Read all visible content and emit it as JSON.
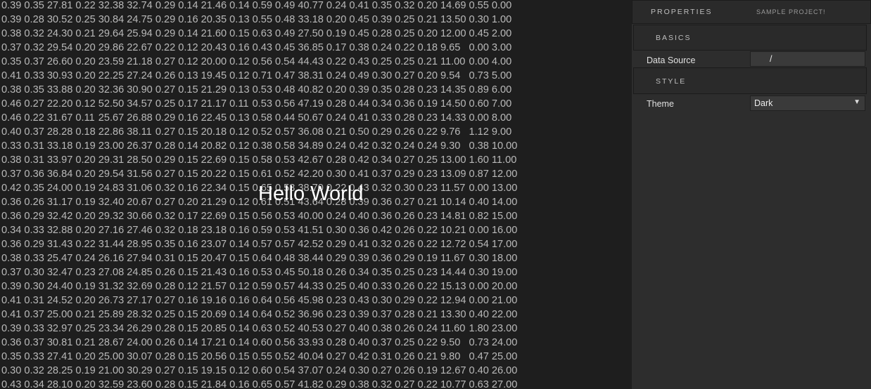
{
  "hello_text": "Hello World",
  "table": [
    [
      "0.39",
      "0.35",
      "27.81",
      "0.22",
      "32.38",
      "32.74",
      "0.29",
      "0.14",
      "21.46",
      "0.14",
      "0.59",
      "0.49",
      "40.77",
      "0.24",
      "0.41",
      "0.35",
      "0.32",
      "0.20",
      "14.69",
      "0.55",
      "0.00"
    ],
    [
      "0.39",
      "0.28",
      "30.52",
      "0.25",
      "30.84",
      "24.75",
      "0.29",
      "0.16",
      "20.35",
      "0.13",
      "0.55",
      "0.48",
      "33.18",
      "0.20",
      "0.45",
      "0.39",
      "0.25",
      "0.21",
      "13.50",
      "0.30",
      "1.00"
    ],
    [
      "0.38",
      "0.32",
      "24.30",
      "0.21",
      "29.64",
      "25.94",
      "0.29",
      "0.14",
      "21.60",
      "0.15",
      "0.63",
      "0.49",
      "27.50",
      "0.19",
      "0.45",
      "0.28",
      "0.25",
      "0.20",
      "12.00",
      "0.45",
      "2.00"
    ],
    [
      "0.37",
      "0.32",
      "29.54",
      "0.20",
      "29.86",
      "22.67",
      "0.22",
      "0.12",
      "20.43",
      "0.16",
      "0.43",
      "0.45",
      "36.85",
      "0.17",
      "0.38",
      "0.24",
      "0.22",
      "0.18",
      "9.65",
      "0.00",
      "3.00"
    ],
    [
      "0.35",
      "0.37",
      "26.60",
      "0.20",
      "23.59",
      "21.18",
      "0.27",
      "0.12",
      "20.00",
      "0.12",
      "0.56",
      "0.54",
      "44.43",
      "0.22",
      "0.43",
      "0.25",
      "0.25",
      "0.21",
      "11.00",
      "0.00",
      "4.00"
    ],
    [
      "0.41",
      "0.33",
      "30.93",
      "0.20",
      "22.25",
      "27.24",
      "0.26",
      "0.13",
      "19.45",
      "0.12",
      "0.71",
      "0.47",
      "38.31",
      "0.24",
      "0.49",
      "0.30",
      "0.27",
      "0.20",
      "9.54",
      "0.73",
      "5.00"
    ],
    [
      "0.38",
      "0.35",
      "33.88",
      "0.20",
      "32.36",
      "30.90",
      "0.27",
      "0.15",
      "21.29",
      "0.13",
      "0.53",
      "0.48",
      "40.82",
      "0.20",
      "0.39",
      "0.35",
      "0.28",
      "0.23",
      "14.35",
      "0.89",
      "6.00"
    ],
    [
      "0.46",
      "0.27",
      "22.20",
      "0.12",
      "52.50",
      "34.57",
      "0.25",
      "0.17",
      "21.17",
      "0.11",
      "0.53",
      "0.56",
      "47.19",
      "0.28",
      "0.44",
      "0.34",
      "0.36",
      "0.19",
      "14.50",
      "0.60",
      "7.00"
    ],
    [
      "0.46",
      "0.22",
      "31.67",
      "0.11",
      "25.67",
      "26.88",
      "0.29",
      "0.16",
      "22.45",
      "0.13",
      "0.58",
      "0.44",
      "50.67",
      "0.24",
      "0.41",
      "0.33",
      "0.28",
      "0.23",
      "14.33",
      "0.00",
      "8.00"
    ],
    [
      "0.40",
      "0.37",
      "28.28",
      "0.18",
      "22.86",
      "38.11",
      "0.27",
      "0.15",
      "20.18",
      "0.12",
      "0.52",
      "0.57",
      "36.08",
      "0.21",
      "0.50",
      "0.29",
      "0.26",
      "0.22",
      "9.76",
      "1.12",
      "9.00"
    ],
    [
      "0.33",
      "0.31",
      "33.18",
      "0.19",
      "23.00",
      "26.37",
      "0.28",
      "0.14",
      "20.82",
      "0.12",
      "0.38",
      "0.58",
      "34.89",
      "0.24",
      "0.42",
      "0.32",
      "0.24",
      "0.24",
      "9.30",
      "0.38",
      "10.00"
    ],
    [
      "0.38",
      "0.31",
      "33.97",
      "0.20",
      "29.31",
      "28.50",
      "0.29",
      "0.15",
      "22.69",
      "0.15",
      "0.58",
      "0.53",
      "42.67",
      "0.28",
      "0.42",
      "0.34",
      "0.27",
      "0.25",
      "13.00",
      "1.60",
      "11.00"
    ],
    [
      "0.37",
      "0.36",
      "36.84",
      "0.20",
      "29.54",
      "31.56",
      "0.27",
      "0.15",
      "20.22",
      "0.15",
      "0.61",
      "0.52",
      "42.20",
      "0.30",
      "0.41",
      "0.37",
      "0.29",
      "0.23",
      "13.09",
      "0.87",
      "12.00"
    ],
    [
      "0.42",
      "0.35",
      "24.00",
      "0.19",
      "24.83",
      "31.06",
      "0.32",
      "0.16",
      "22.34",
      "0.15",
      "0.65",
      "0.53",
      "38.70",
      "0.22",
      "0.43",
      "0.32",
      "0.30",
      "0.23",
      "11.57",
      "0.00",
      "13.00"
    ],
    [
      "0.36",
      "0.26",
      "31.17",
      "0.19",
      "32.40",
      "20.67",
      "0.27",
      "0.20",
      "21.29",
      "0.12",
      "0.61",
      "0.51",
      "43.64",
      "0.28",
      "0.39",
      "0.36",
      "0.27",
      "0.21",
      "10.14",
      "0.40",
      "14.00"
    ],
    [
      "0.36",
      "0.29",
      "32.42",
      "0.20",
      "29.32",
      "30.66",
      "0.32",
      "0.17",
      "22.69",
      "0.15",
      "0.56",
      "0.53",
      "40.00",
      "0.24",
      "0.40",
      "0.36",
      "0.26",
      "0.23",
      "14.81",
      "0.82",
      "15.00"
    ],
    [
      "0.34",
      "0.33",
      "32.88",
      "0.20",
      "27.16",
      "27.46",
      "0.32",
      "0.18",
      "23.18",
      "0.16",
      "0.59",
      "0.53",
      "41.51",
      "0.30",
      "0.36",
      "0.42",
      "0.26",
      "0.22",
      "10.21",
      "0.00",
      "16.00"
    ],
    [
      "0.36",
      "0.29",
      "31.43",
      "0.22",
      "31.44",
      "28.95",
      "0.35",
      "0.16",
      "23.07",
      "0.14",
      "0.57",
      "0.57",
      "42.52",
      "0.29",
      "0.41",
      "0.32",
      "0.26",
      "0.22",
      "12.72",
      "0.54",
      "17.00"
    ],
    [
      "0.38",
      "0.33",
      "25.47",
      "0.24",
      "26.16",
      "27.94",
      "0.31",
      "0.15",
      "20.47",
      "0.15",
      "0.64",
      "0.48",
      "38.44",
      "0.29",
      "0.39",
      "0.36",
      "0.29",
      "0.19",
      "11.67",
      "0.30",
      "18.00"
    ],
    [
      "0.37",
      "0.30",
      "32.47",
      "0.23",
      "27.08",
      "24.85",
      "0.26",
      "0.15",
      "21.43",
      "0.16",
      "0.53",
      "0.45",
      "50.18",
      "0.26",
      "0.34",
      "0.35",
      "0.25",
      "0.23",
      "14.44",
      "0.30",
      "19.00"
    ],
    [
      "0.39",
      "0.30",
      "24.40",
      "0.19",
      "31.32",
      "32.69",
      "0.28",
      "0.12",
      "21.57",
      "0.12",
      "0.59",
      "0.57",
      "44.33",
      "0.25",
      "0.40",
      "0.33",
      "0.26",
      "0.22",
      "15.13",
      "0.00",
      "20.00"
    ],
    [
      "0.41",
      "0.31",
      "24.52",
      "0.20",
      "26.73",
      "27.17",
      "0.27",
      "0.16",
      "19.16",
      "0.16",
      "0.64",
      "0.56",
      "45.98",
      "0.23",
      "0.43",
      "0.30",
      "0.29",
      "0.22",
      "12.94",
      "0.00",
      "21.00"
    ],
    [
      "0.41",
      "0.37",
      "25.00",
      "0.21",
      "25.89",
      "28.32",
      "0.25",
      "0.15",
      "20.69",
      "0.14",
      "0.64",
      "0.52",
      "36.96",
      "0.23",
      "0.39",
      "0.37",
      "0.28",
      "0.21",
      "13.30",
      "0.40",
      "22.00"
    ],
    [
      "0.39",
      "0.33",
      "32.97",
      "0.25",
      "23.34",
      "26.29",
      "0.28",
      "0.15",
      "20.85",
      "0.14",
      "0.63",
      "0.52",
      "40.53",
      "0.27",
      "0.40",
      "0.38",
      "0.26",
      "0.24",
      "11.60",
      "1.80",
      "23.00"
    ],
    [
      "0.36",
      "0.37",
      "30.81",
      "0.21",
      "28.67",
      "24.00",
      "0.26",
      "0.14",
      "17.21",
      "0.14",
      "0.60",
      "0.56",
      "33.93",
      "0.28",
      "0.40",
      "0.37",
      "0.25",
      "0.22",
      "9.50",
      "0.73",
      "24.00"
    ],
    [
      "0.35",
      "0.33",
      "27.41",
      "0.20",
      "25.00",
      "30.07",
      "0.28",
      "0.15",
      "20.56",
      "0.15",
      "0.55",
      "0.52",
      "40.04",
      "0.27",
      "0.42",
      "0.31",
      "0.26",
      "0.21",
      "9.80",
      "0.47",
      "25.00"
    ],
    [
      "0.30",
      "0.32",
      "28.25",
      "0.19",
      "21.00",
      "30.29",
      "0.27",
      "0.15",
      "19.15",
      "0.12",
      "0.60",
      "0.54",
      "37.07",
      "0.24",
      "0.30",
      "0.27",
      "0.26",
      "0.19",
      "12.67",
      "0.40",
      "26.00"
    ],
    [
      "0.43",
      "0.34",
      "28.10",
      "0.20",
      "32.59",
      "23.60",
      "0.28",
      "0.15",
      "21.84",
      "0.16",
      "0.65",
      "0.57",
      "41.82",
      "0.29",
      "0.38",
      "0.32",
      "0.27",
      "0.22",
      "10.77",
      "0.63",
      "27.00"
    ]
  ],
  "panel": {
    "properties_label": "PROPERTIES",
    "project_label": "SAMPLE PROJECT!",
    "basics_label": "BASICS",
    "data_source_label": "Data Source",
    "data_source_value": "/",
    "style_label": "STYLE",
    "theme_label": "Theme",
    "theme_value": "Dark",
    "dropdown_arrow": "▼"
  }
}
